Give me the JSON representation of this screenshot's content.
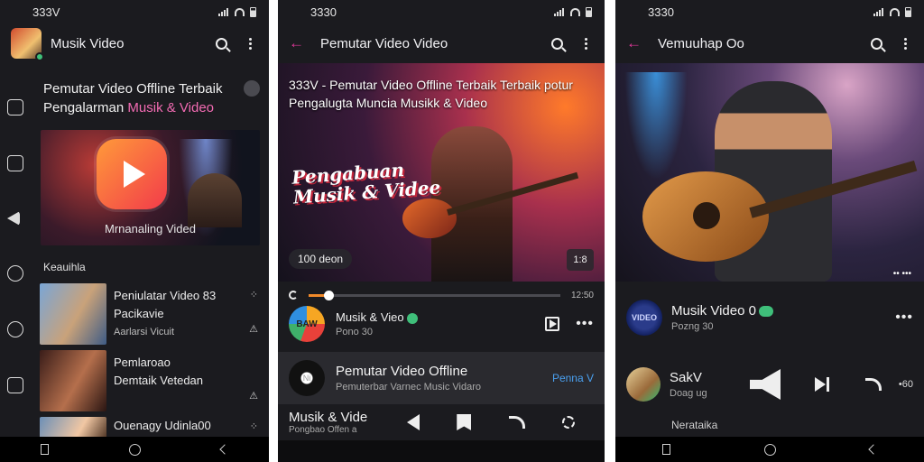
{
  "screen1": {
    "status_time": "333V",
    "app_title": "Musik Video",
    "heading_line1": "Pemutar Video Offline Terbaik",
    "heading_prefix": "Pengalarman ",
    "heading_accent": "Musik & Video",
    "banner_caption": "Mrnanaling Vided",
    "section_title": "Keauihla",
    "list": [
      {
        "title": "Peniulatar Video 83",
        "subtitle": "Pacikavie",
        "meta": "Aarlarsi Vicuit"
      },
      {
        "title": "Pemlaroao",
        "subtitle": "Demtaik Vetedan",
        "meta": ""
      },
      {
        "title": "Ouenagy Udinla00",
        "subtitle": "",
        "meta": ""
      }
    ]
  },
  "screen2": {
    "status_time": "3330",
    "app_title": "Pemutar Video Video",
    "hero_headline": "333V - Pemutar Video Offline Terbaik Terbaik potur Pengalugta Muncia Musikk & Video",
    "hero_logo_line1": "Pengabuan",
    "hero_logo_line2": "Musik & Videe",
    "hero_views": "100 deon",
    "fullscreen_label": "1:8",
    "progress": 0.08,
    "time_label": "12:50",
    "now_playing_title": "Musik & Vieo",
    "now_playing_sub": "Pono 30",
    "orb_label": "BAW",
    "card_title": "Pemutar Video Offline",
    "card_sub": "Pemuterbar Varnec Music Vidaro",
    "card_link": "Penna V",
    "disc_label": "Ni",
    "mini_title": "Musik & Vide",
    "mini_sub": "Pongbao Offen a"
  },
  "screen3": {
    "status_time": "3330",
    "app_title": "Vemuuhap Oo",
    "hero_actions": "•• •••",
    "row1_title": "Musik Video 0",
    "row1_sub": "Pozng 30",
    "orb_label": "VIDEO",
    "row2_title": "SakV",
    "row2_sub": "Doag ug",
    "row2_right": "•60",
    "footer_text": "Nerataika"
  },
  "icons": [
    "search-icon",
    "more-icon",
    "back-arrow-icon",
    "play-icon",
    "bookmark-icon",
    "share-icon",
    "loop-icon",
    "next-icon",
    "home-icon",
    "recents-icon",
    "nav-back-icon"
  ],
  "colors": {
    "accent_pink": "#e0389a",
    "accent_orange": "#f18a2a",
    "link_blue": "#4aa0f0",
    "background": "#1b1b1f"
  }
}
